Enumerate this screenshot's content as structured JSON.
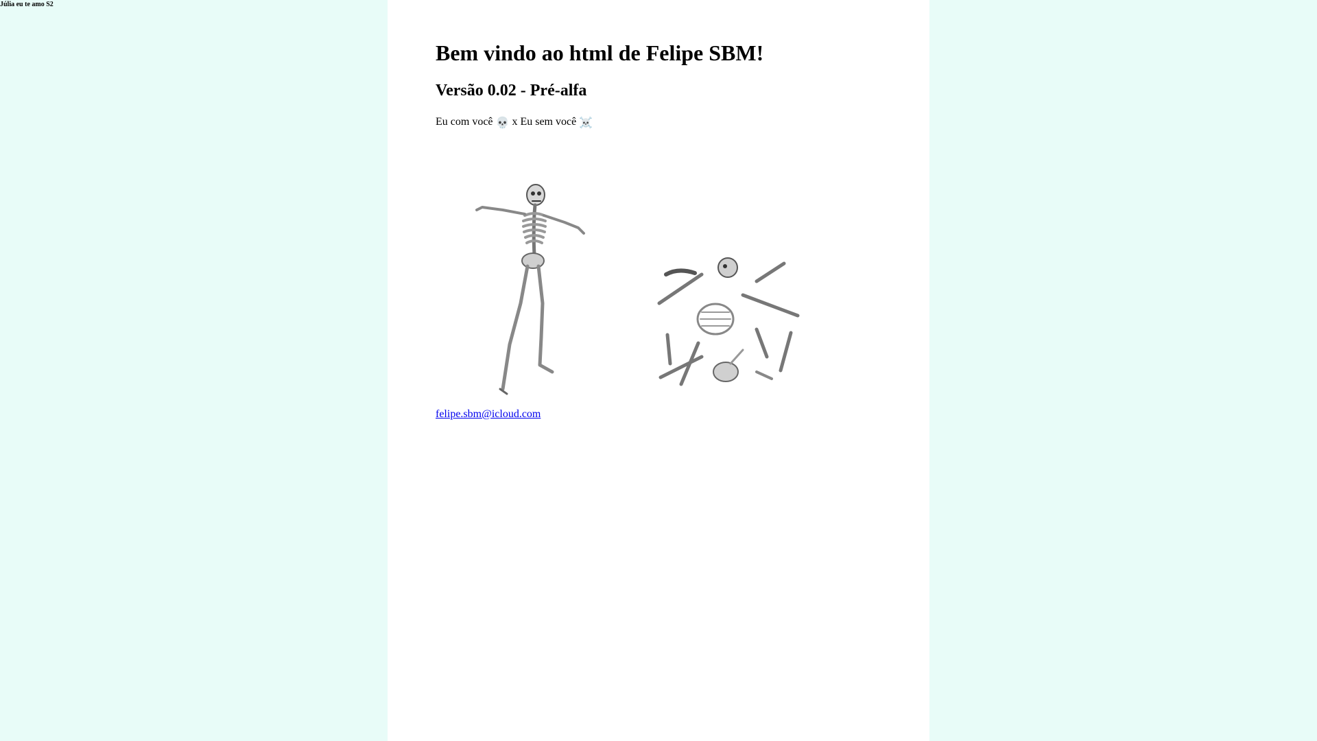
{
  "corner_note": "Júlia eu te amo S2",
  "main": {
    "heading": "Bem vindo ao html de Felipe SBM!",
    "subheading": "Versão 0.02 - Pré-alfa",
    "compare_text_start": "Eu com você ",
    "compare_emoji_1": "💀",
    "compare_text_middle": " x Eu sem você ",
    "compare_emoji_2": "☠️",
    "images": [
      {
        "name": "dancing-skeleton",
        "description_icon": "skeleton-figure"
      },
      {
        "name": "scattered-bones",
        "description_icon": "bones-pile"
      }
    ],
    "email": "felipe.sbm@icloud.com"
  },
  "colors": {
    "page_background": "#e8fcf8",
    "panel_background": "#ffffff",
    "link": "#0000ee"
  }
}
